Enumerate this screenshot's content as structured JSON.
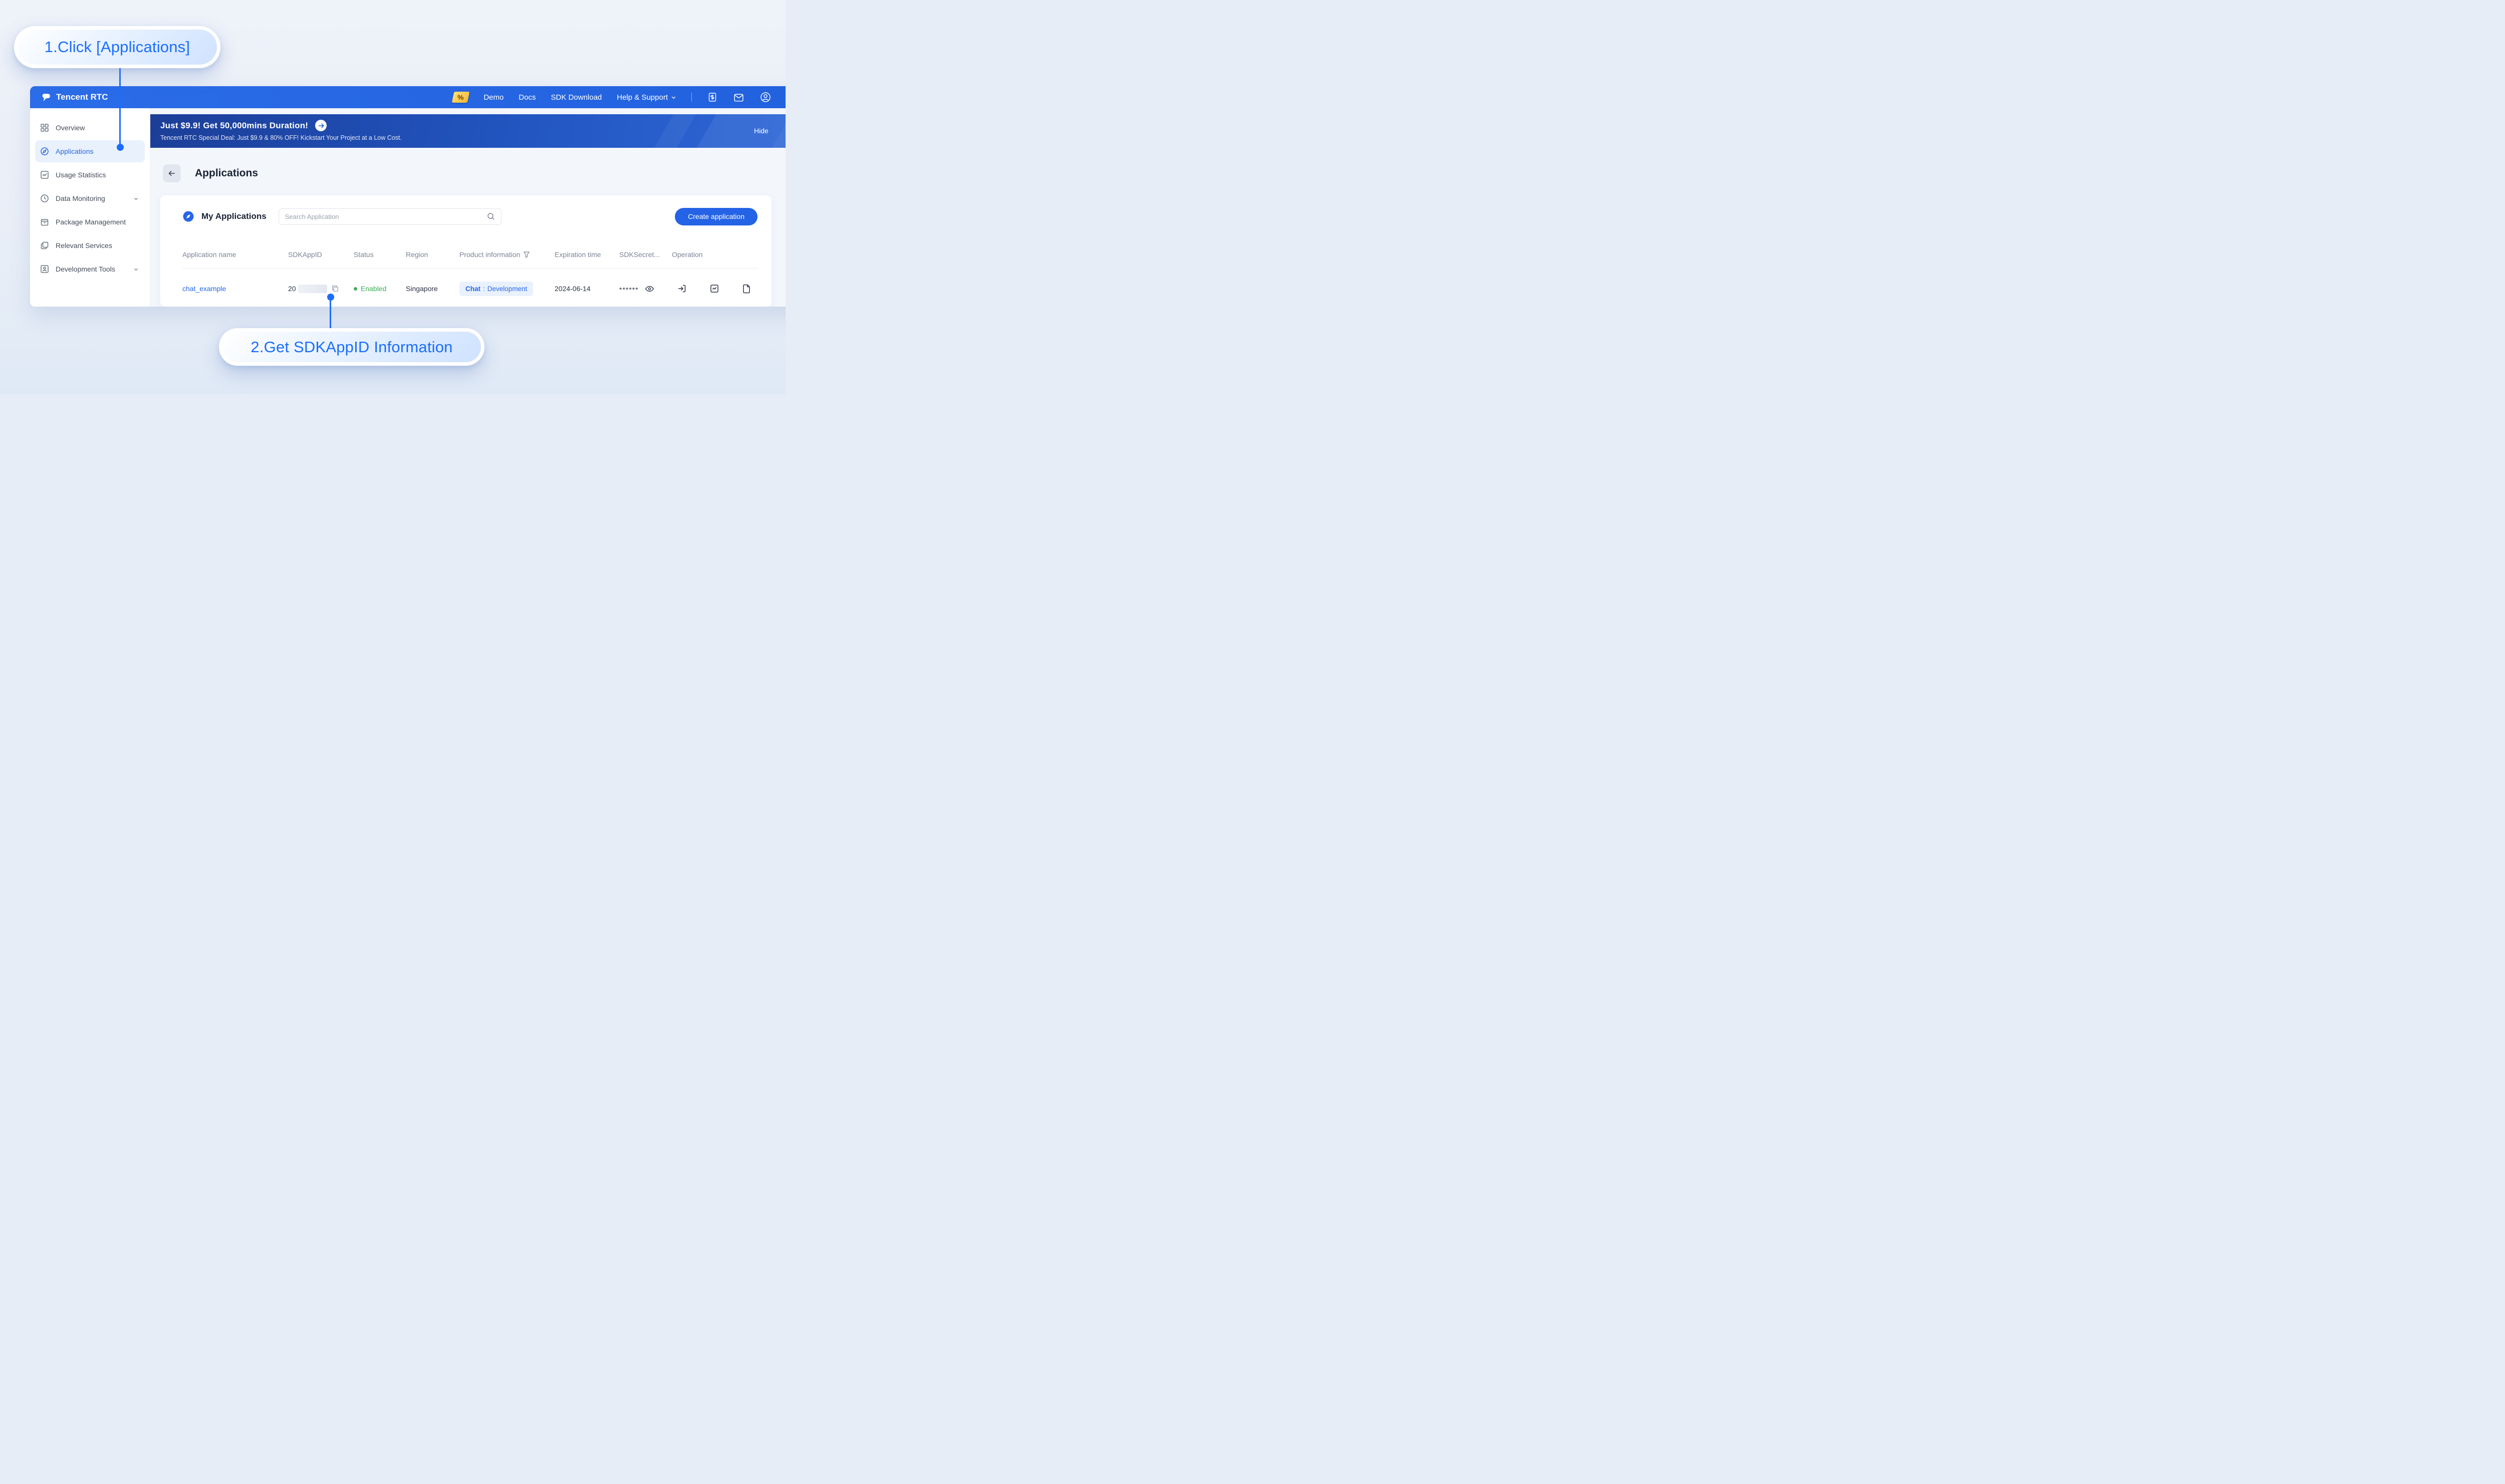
{
  "callouts": {
    "step1": "1.Click [Applications]",
    "step2": "2.Get SDKAppID Information"
  },
  "topnav": {
    "brand": "Tencent RTC",
    "coupon": "%",
    "items": [
      {
        "label": "Demo"
      },
      {
        "label": "Docs"
      },
      {
        "label": "SDK Download"
      },
      {
        "label": "Help & Support"
      }
    ]
  },
  "sidebar": {
    "items": [
      {
        "label": "Overview"
      },
      {
        "label": "Applications"
      },
      {
        "label": "Usage Statistics"
      },
      {
        "label": "Data Monitoring"
      },
      {
        "label": "Package Management"
      },
      {
        "label": "Relevant Services"
      },
      {
        "label": "Development Tools"
      }
    ]
  },
  "banner": {
    "title": "Just $9.9! Get 50,000mins Duration!",
    "subtitle": "Tencent RTC Special Deal: Just $9.9 & 80% OFF! Kickstart Your Project at a Low Cost.",
    "hide": "Hide"
  },
  "page": {
    "title": "Applications"
  },
  "card": {
    "title": "My Applications",
    "search_placeholder": "Search Application",
    "create_button": "Create application"
  },
  "table": {
    "headers": [
      "Application name",
      "SDKAppID",
      "Status",
      "Region",
      "Product information",
      "Expiration time",
      "SDKSecret...",
      "Operation"
    ],
    "row": {
      "name": "chat_example",
      "sdkappid_prefix": "20",
      "status": "Enabled",
      "region": "Singapore",
      "product_name": "Chat",
      "product_separator": ":",
      "product_env": "Development",
      "expiration": "2024-06-14",
      "secret_mask": "******"
    }
  },
  "colors": {
    "accent_blue": "#2667e8",
    "status_green": "#3fae5a"
  }
}
